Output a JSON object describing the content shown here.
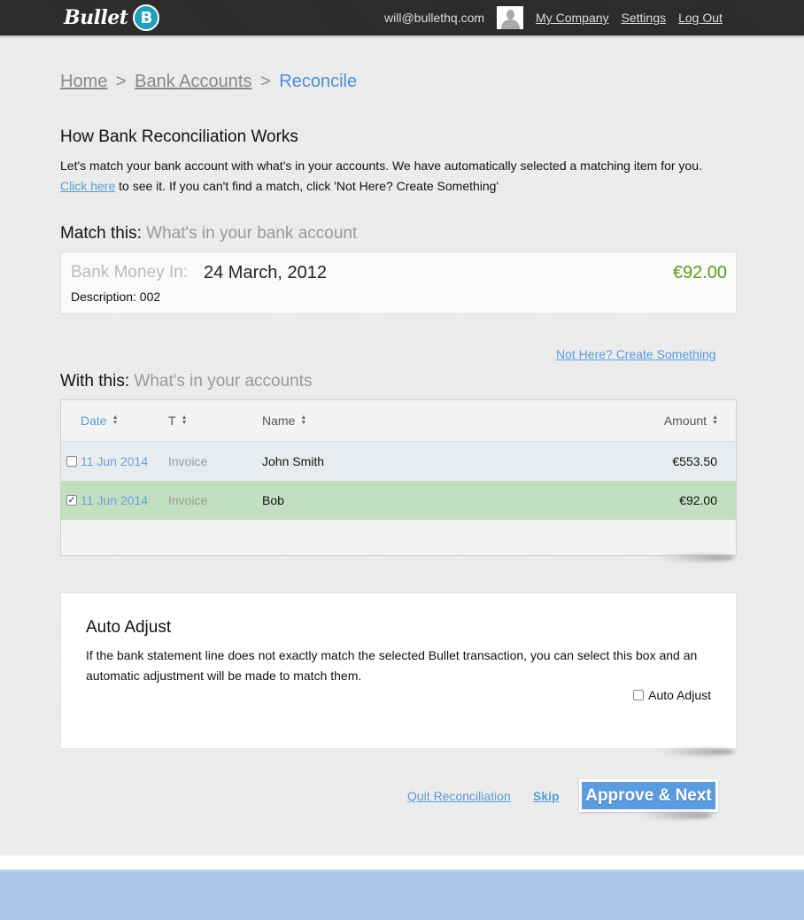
{
  "header": {
    "logo_text": "Bullet",
    "logo_badge": "B",
    "email": "will@bullethq.com",
    "links": [
      "My Company",
      "Settings",
      "Log Out"
    ]
  },
  "breadcrumb": {
    "items": [
      "Home",
      "Bank Accounts"
    ],
    "separator": ">",
    "current": "Reconcile"
  },
  "intro": {
    "title": "How Bank Reconciliation Works",
    "line1": "Let's match your bank account with what's in your accounts. We have automatically selected a matching item for you.",
    "link": "Click here",
    "line2_rest": " to see it. If you can't find a match, click 'Not Here? Create Something'"
  },
  "match": {
    "title": "Match this:",
    "subtitle": "What's in your bank account",
    "label": "Bank Money In:",
    "date": "24 March, 2012",
    "amount": "€92.00",
    "description": "Description: 002",
    "amount_color": "#5a9e1a"
  },
  "not_here_link": "Not Here? Create Something",
  "with": {
    "title": "With this:",
    "subtitle": "What's in your accounts",
    "columns": [
      "Date",
      "T",
      "Name",
      "Amount"
    ],
    "sorted_column": "Date",
    "rows": [
      {
        "checked": false,
        "date": "11 Jun 2014",
        "type": "Invoice",
        "name": "John Smith",
        "amount": "€553.50"
      },
      {
        "checked": true,
        "date": "11 Jun 2014",
        "type": "Invoice",
        "name": "Bob",
        "amount": "€92.00"
      }
    ]
  },
  "auto_adjust": {
    "title": "Auto Adjust",
    "text": "If the bank statement line does not exactly match the selected Bullet transaction, you can select this box and an automatic adjustment will be made to match them.",
    "checkbox_label": "Auto Adjust",
    "checked": false
  },
  "actions": {
    "quit": "Quit Reconciliation",
    "skip": "Skip",
    "approve": "Approve & Next"
  },
  "colors": {
    "accent": "#5b9be0",
    "selected_row": "#c2dfc0",
    "topbar": "#2b2b2b",
    "footer": "#adc6e6"
  }
}
